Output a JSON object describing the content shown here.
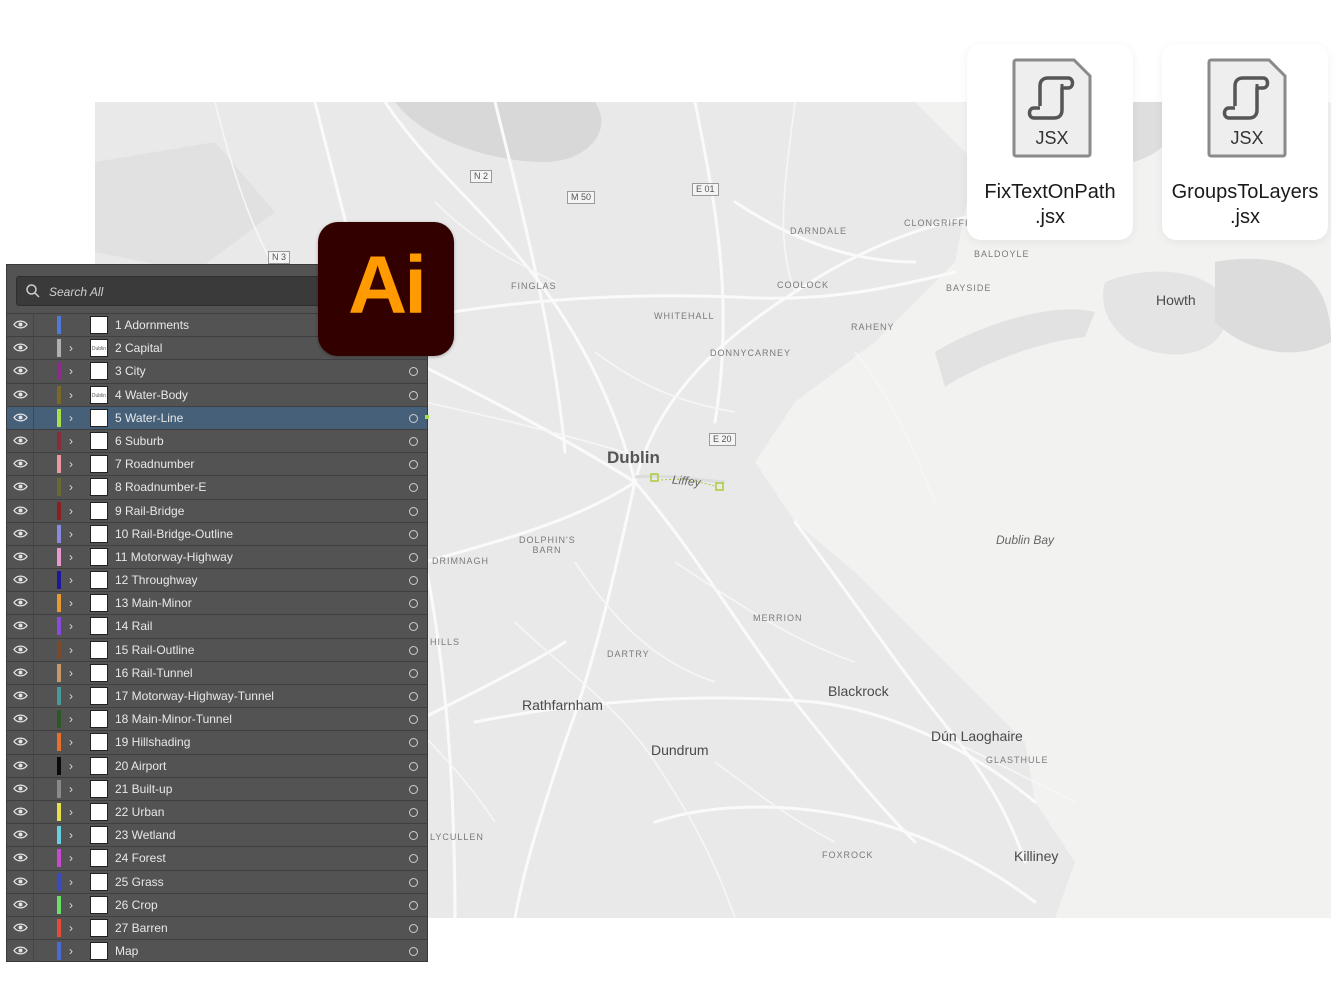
{
  "map": {
    "labels": {
      "dublin": "Dublin",
      "liffey": "Liffey",
      "dublin_bay": "Dublin Bay",
      "howth": "Howth",
      "blackrock": "Blackrock",
      "dun_laoghaire": "Dún Laoghaire",
      "rathfarnham": "Rathfarnham",
      "dundrum": "Dundrum",
      "killiney": "Killiney",
      "finglas": "FINGLAS",
      "whitehall": "WHITEHALL",
      "coolock": "COOLOCK",
      "darndale": "DARNDALE",
      "clongriffin": "CLONGRIFFIN",
      "baldoyle": "BALDOYLE",
      "bayside": "BAYSIDE",
      "raheny": "RAHENY",
      "donnycarney": "DONNYCARNEY",
      "dolphins_barn": "DOLPHIN'S BARN",
      "drimnagh": "DRIMNAGH",
      "merrion": "MERRION",
      "dartry": "DARTRY",
      "glasthule": "GLASTHULE",
      "foxrock": "FOXROCK",
      "hills": "HILLS",
      "lycullen": "LYCULLEN"
    },
    "shields": {
      "n2": "N 2",
      "m50": "M 50",
      "e01": "E 01",
      "n3": "N 3",
      "e20": "E 20"
    }
  },
  "files": [
    {
      "icon_text": "JSX",
      "name_line1": "FixTextOnPath",
      "name_line2": ".jsx"
    },
    {
      "icon_text": "JSX",
      "name_line1": "GroupsToLayers",
      "name_line2": ".jsx"
    }
  ],
  "app_logo": {
    "text": "Ai",
    "background": "#330000",
    "color": "#ff9a00"
  },
  "layers_panel": {
    "search_placeholder": "Search All",
    "selected_layer": "5 Water-Line",
    "layers": [
      {
        "name": "1 Adornments",
        "color": "#4f7ad6"
      },
      {
        "name": "2 Capital",
        "color": "#b0b0b0",
        "thumb_text": "Dublin"
      },
      {
        "name": "3 City",
        "color": "#8a2e8a"
      },
      {
        "name": "4 Water-Body",
        "color": "#7a6a2a",
        "thumb_text": "Dublin Bay"
      },
      {
        "name": "5 Water-Line",
        "color": "#a9e04a"
      },
      {
        "name": "6 Suburb",
        "color": "#8a2c3a"
      },
      {
        "name": "7 Roadnumber",
        "color": "#e89aa0"
      },
      {
        "name": "8 Roadnumber-E",
        "color": "#6a6a30"
      },
      {
        "name": "9 Rail-Bridge",
        "color": "#8a2020"
      },
      {
        "name": "10 Rail-Bridge-Outline",
        "color": "#8a8ae0"
      },
      {
        "name": "11 Motorway-Highway",
        "color": "#e89ad0"
      },
      {
        "name": "12 Throughway",
        "color": "#1a1a9a"
      },
      {
        "name": "13 Main-Minor",
        "color": "#e89a30"
      },
      {
        "name": "14 Rail",
        "color": "#8a4ae0"
      },
      {
        "name": "15 Rail-Outline",
        "color": "#7a4a2a"
      },
      {
        "name": "16 Rail-Tunnel",
        "color": "#c89a6a"
      },
      {
        "name": "17 Motorway-Highway-Tunnel",
        "color": "#4a9a9a"
      },
      {
        "name": "18 Main-Minor-Tunnel",
        "color": "#2a5a2a"
      },
      {
        "name": "19 Hillshading",
        "color": "#e8702a"
      },
      {
        "name": "20 Airport",
        "color": "#0a0a0a"
      },
      {
        "name": "21 Built-up",
        "color": "#8a8a8a"
      },
      {
        "name": "22 Urban",
        "color": "#e8e04a"
      },
      {
        "name": "23 Wetland",
        "color": "#6ad0e0"
      },
      {
        "name": "24 Forest",
        "color": "#c84ad0"
      },
      {
        "name": "25 Grass",
        "color": "#3a4ac0"
      },
      {
        "name": "26 Crop",
        "color": "#6ae06a"
      },
      {
        "name": "27 Barren",
        "color": "#e84a3a"
      },
      {
        "name": "Map",
        "color": "#4a6ad6"
      }
    ]
  }
}
